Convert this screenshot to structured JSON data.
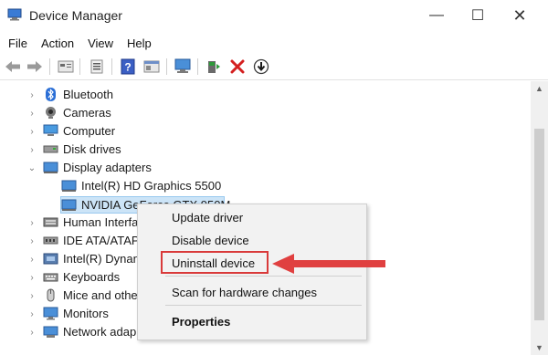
{
  "window": {
    "title": "Device Manager",
    "minimize": "—",
    "maximize": "☐",
    "close": "✕"
  },
  "menu": [
    "File",
    "Action",
    "View",
    "Help"
  ],
  "toolbar_icons": [
    "back-arrow-icon",
    "forward-arrow-icon",
    "properties-icon",
    "device-list-icon",
    "help-icon",
    "resource-view-icon",
    "monitor-icon",
    "update-driver-icon",
    "uninstall-icon",
    "download-icon"
  ],
  "tree": [
    {
      "label": "Bluetooth",
      "icon": "bluetooth-icon",
      "expanded": false
    },
    {
      "label": "Cameras",
      "icon": "camera-icon",
      "expanded": false
    },
    {
      "label": "Computer",
      "icon": "computer-icon",
      "expanded": false
    },
    {
      "label": "Disk drives",
      "icon": "disk-drive-icon",
      "expanded": false
    },
    {
      "label": "Display adapters",
      "icon": "display-adapter-icon",
      "expanded": true
    },
    {
      "label": "Intel(R) HD Graphics 5500",
      "icon": "display-adapter-icon",
      "child": true
    },
    {
      "label": "NVIDIA GeForce GTX 950M",
      "icon": "display-adapter-icon",
      "child": true,
      "selected": true
    },
    {
      "label": "Human Interfa",
      "icon": "hid-icon",
      "expanded": false
    },
    {
      "label": "IDE ATA/ATAPI",
      "icon": "ide-icon",
      "expanded": false
    },
    {
      "label": "Intel(R) Dynan",
      "icon": "intel-icon",
      "expanded": false
    },
    {
      "label": "Keyboards",
      "icon": "keyboard-icon",
      "expanded": false
    },
    {
      "label": "Mice and othe",
      "icon": "mouse-icon",
      "expanded": false
    },
    {
      "label": "Monitors",
      "icon": "monitor-icon",
      "expanded": false
    },
    {
      "label": "Network adap",
      "icon": "network-icon",
      "expanded": false
    }
  ],
  "context_menu": {
    "items": [
      "Update driver",
      "Disable device",
      "Uninstall device",
      "Scan for hardware changes",
      "Properties"
    ]
  },
  "colors": {
    "selection": "#cce4f7",
    "highlight": "#d93a3a",
    "arrow": "#e04040"
  }
}
